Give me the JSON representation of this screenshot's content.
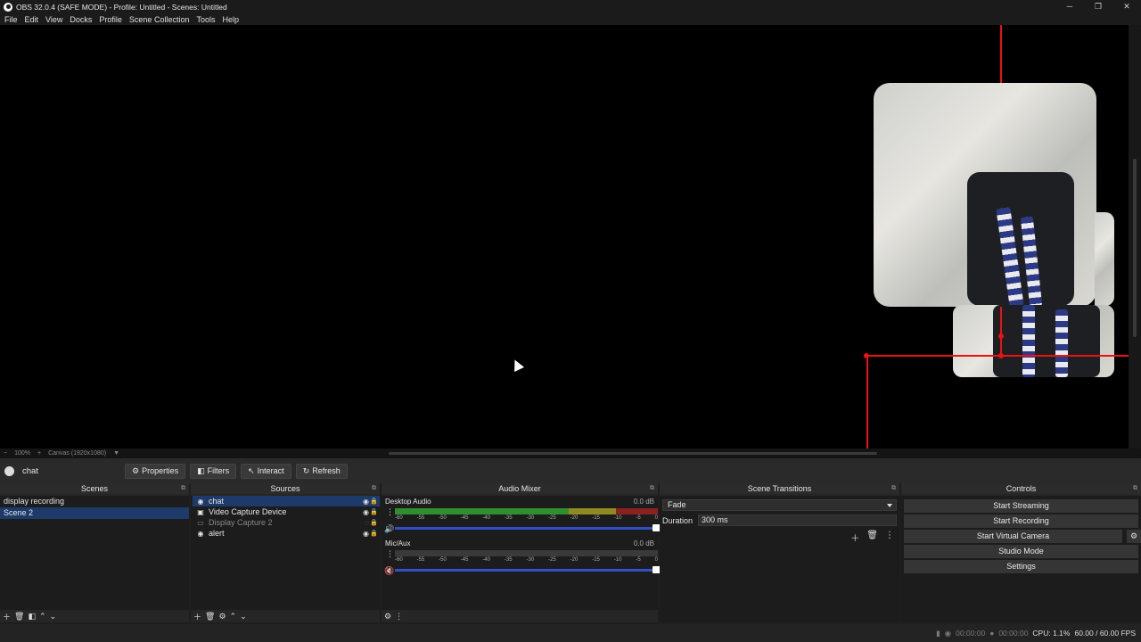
{
  "window": {
    "title": "OBS 32.0.4 (SAFE MODE) - Profile: Untitled - Scenes: Untitled",
    "minimize": "─",
    "maximize": "❐",
    "close": "✕"
  },
  "menu": [
    "File",
    "Edit",
    "View",
    "Docks",
    "Profile",
    "Scene Collection",
    "Tools",
    "Help"
  ],
  "zoom": {
    "minus": "−",
    "level": "100%",
    "plus": "+",
    "canvas": "Canvas (1920x1080)"
  },
  "context": {
    "source_name": "chat",
    "properties": "Properties",
    "filters": "Filters",
    "interact": "Interact",
    "refresh": "Refresh"
  },
  "scenes": {
    "title": "Scenes",
    "items": [
      "display recording",
      "Scene 2"
    ],
    "selected": "Scene 2"
  },
  "sources": {
    "title": "Sources",
    "items": [
      {
        "name": "chat",
        "icon": "globe-icon",
        "visible": true,
        "selected": true
      },
      {
        "name": "Video Capture Device",
        "icon": "camera-icon",
        "visible": true
      },
      {
        "name": "Display Capture 2",
        "icon": "monitor-icon",
        "visible": false
      },
      {
        "name": "alert",
        "icon": "globe-icon",
        "visible": true
      }
    ]
  },
  "mixer": {
    "title": "Audio Mixer",
    "ticks": [
      "-60",
      "-55",
      "-50",
      "-45",
      "-40",
      "-35",
      "-30",
      "-25",
      "-20",
      "-15",
      "-10",
      "-5",
      "0"
    ],
    "channels": [
      {
        "name": "Desktop Audio",
        "db": "0.0 dB",
        "muted": false,
        "level": 1.0
      },
      {
        "name": "Mic/Aux",
        "db": "0.0 dB",
        "muted": true,
        "level": 1.0
      }
    ]
  },
  "transitions": {
    "title": "Scene Transitions",
    "selected": "Fade",
    "duration_label": "Duration",
    "duration_value": "300 ms"
  },
  "controls": {
    "title": "Controls",
    "start_streaming": "Start Streaming",
    "start_recording": "Start Recording",
    "start_virtual_camera": "Start Virtual Camera",
    "studio_mode": "Studio Mode",
    "settings": "Settings"
  },
  "status": {
    "stream_time": "00:00:00",
    "record_time": "00:00:00",
    "cpu": "CPU: 1.1%",
    "fps": "60.00 / 60.00 FPS"
  },
  "colors": {
    "selection": "#1e3a6a",
    "meter_green": "#2f8f2f",
    "meter_yellow": "#8f8a22",
    "meter_red": "#8a2222",
    "volume_slider": "#3150c8",
    "bounding_box": "#ee1111"
  }
}
